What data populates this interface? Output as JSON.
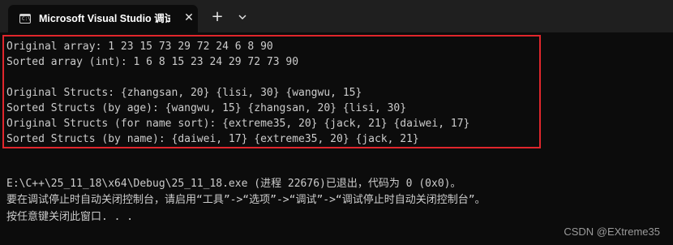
{
  "titlebar": {
    "tab_icon": "console-icon",
    "tab_icon_glyph": "C:\\",
    "tab_title": "Microsoft Visual Studio 调试控制台",
    "close_glyph": "✕",
    "new_tab_glyph": "+",
    "dropdown_icon": "chevron-down-icon"
  },
  "console": {
    "lines": [
      "Original array: 1 23 15 73 29 72 24 6 8 90",
      "Sorted array (int): 1 6 8 15 23 24 29 72 73 90",
      "",
      "Original Structs: {zhangsan, 20} {lisi, 30} {wangwu, 15}",
      "Sorted Structs (by age): {wangwu, 15} {zhangsan, 20} {lisi, 30}",
      "Original Structs (for name sort): {extreme35, 20} {jack, 21} {daiwei, 17}",
      "Sorted Structs (by name): {daiwei, 17} {extreme35, 20} {jack, 21}",
      "",
      "",
      "E:\\C++\\25_11_18\\x64\\Debug\\25_11_18.exe (进程 22676)已退出，代码为 0 (0x0)。",
      "要在调试停止时自动关闭控制台，请启用“工具”->“选项”->“调试”->“调试停止时自动关闭控制台”。",
      "按任意键关闭此窗口. . ."
    ],
    "highlight_color": "#e0262c",
    "text_color": "#cccccc",
    "background_color": "#0c0c0c"
  },
  "watermark": "CSDN @EXtreme35"
}
